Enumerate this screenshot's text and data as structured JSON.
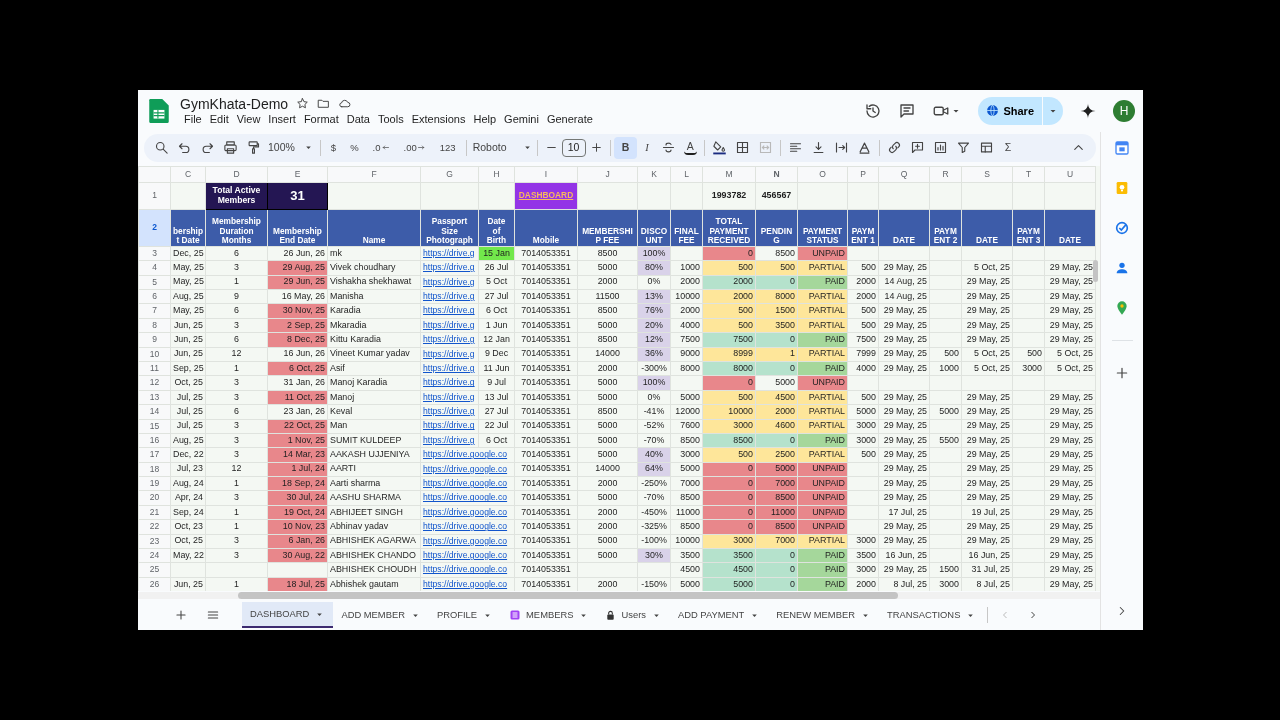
{
  "doc": {
    "title": "GymKhata-Demo",
    "menu": [
      "File",
      "Edit",
      "View",
      "Insert",
      "Format",
      "Data",
      "Tools",
      "Extensions",
      "Help",
      "Gemini",
      "Generate"
    ],
    "share_label": "Share",
    "avatar_initial": "H"
  },
  "toolbar": {
    "zoom": "100%",
    "number_formats": [
      {
        "label": "$",
        "kind": "plain"
      },
      {
        "label": "%",
        "kind": "plain"
      },
      {
        "label": ".0",
        "kind": "decrease"
      },
      {
        "label": ".00",
        "kind": "increase"
      },
      {
        "label": "123",
        "kind": "plain"
      }
    ],
    "font": "Roboto",
    "font_size": "10",
    "text_styles": [
      {
        "label": "B",
        "kind": "bold",
        "selected": true
      },
      {
        "label": "I",
        "kind": "italic",
        "selected": false
      }
    ],
    "text_color_label": "A",
    "functions_label": "Σ"
  },
  "columns": [
    {
      "letter": "C",
      "selected": false
    },
    {
      "letter": "D",
      "selected": false
    },
    {
      "letter": "E",
      "selected": false
    },
    {
      "letter": "F",
      "selected": false
    },
    {
      "letter": "G",
      "selected": false
    },
    {
      "letter": "H",
      "selected": false
    },
    {
      "letter": "I",
      "selected": false
    },
    {
      "letter": "J",
      "selected": false
    },
    {
      "letter": "K",
      "selected": false
    },
    {
      "letter": "L",
      "selected": false
    },
    {
      "letter": "M",
      "selected": false
    },
    {
      "letter": "N",
      "selected": true
    },
    {
      "letter": "O",
      "selected": false
    },
    {
      "letter": "P",
      "selected": false
    },
    {
      "letter": "Q",
      "selected": false
    },
    {
      "letter": "R",
      "selected": false
    },
    {
      "letter": "S",
      "selected": false
    },
    {
      "letter": "T",
      "selected": false
    },
    {
      "letter": "U",
      "selected": false
    }
  ],
  "summary": {
    "num": "1",
    "selected": false,
    "active_label": "Total Active Members",
    "active_count": "31",
    "dashboard_link": "DASHBOARD",
    "total_received": "1993782",
    "total_pending": "456567"
  },
  "header_row": {
    "num": "2",
    "selected": true,
    "titles": [
      "bership\nt Date",
      "Membership\nDuration\nMonths",
      "Membership\nEnd Date",
      "Name",
      "Passport\nSize\nPhotograph",
      "Date\nof\nBirth",
      "Mobile",
      "MEMBERSHI\nP FEE",
      "DISCO\nUNT",
      "FINAL\nFEE",
      "TOTAL\nPAYMENT\nRECEIVED",
      "PENDIN\nG",
      "PAYMENT\nSTATUS",
      "PAYM\nENT 1",
      "DATE",
      "PAYM\nENT 2",
      "DATE",
      "PAYM\nENT 3",
      "DATE"
    ]
  },
  "rows": [
    {
      "num": "3",
      "selected": false,
      "expired": false,
      "birthday": true,
      "discount_flag": true,
      "pending_flag": false,
      "kind": "unpaid",
      "cells": [
        "Dec, 25",
        "6",
        "26 Jun, 26",
        "mk",
        "https://drive.g",
        "15 Jan",
        "7014053351",
        "8500",
        "100%",
        null,
        "0",
        "8500",
        "UNPAID",
        null,
        null,
        null,
        null,
        null,
        null
      ]
    },
    {
      "num": "4",
      "selected": false,
      "expired": true,
      "birthday": false,
      "discount_flag": true,
      "pending_flag": true,
      "kind": "partial",
      "cells": [
        "May, 25",
        "3",
        "29 Aug, 25",
        "Vivek choudhary",
        "https://drive.g",
        "26 Jul",
        "7014053351",
        "5000",
        "80%",
        "1000",
        "500",
        "500",
        "PARTIAL",
        "500",
        "29 May, 25",
        null,
        "5 Oct, 25",
        null,
        "29 May, 25"
      ]
    },
    {
      "num": "5",
      "selected": false,
      "expired": true,
      "birthday": false,
      "discount_flag": false,
      "pending_flag": true,
      "kind": "paid",
      "cells": [
        "May, 25",
        "1",
        "29 Jun, 25",
        "Vishakha shekhawat",
        "https://drive.g",
        "5 Oct",
        "7014053351",
        "2000",
        "0%",
        "2000",
        "2000",
        "0",
        "PAID",
        "2000",
        "14 Aug, 25",
        null,
        "29 May, 25",
        null,
        "29 May, 25"
      ]
    },
    {
      "num": "6",
      "selected": false,
      "expired": false,
      "birthday": false,
      "discount_flag": true,
      "pending_flag": true,
      "kind": "partial",
      "cells": [
        "Aug, 25",
        "9",
        "16 May, 26",
        "Manisha",
        "https://drive.g",
        "27 Jul",
        "7014053351",
        "11500",
        "13%",
        "10000",
        "2000",
        "8000",
        "PARTIAL",
        "2000",
        "14 Aug, 25",
        null,
        "29 May, 25",
        null,
        "29 May, 25"
      ]
    },
    {
      "num": "7",
      "selected": false,
      "expired": true,
      "birthday": false,
      "discount_flag": true,
      "pending_flag": true,
      "kind": "partial",
      "cells": [
        "May, 25",
        "6",
        "30 Nov, 25",
        "Karadia",
        "https://drive.g",
        "6 Oct",
        "7014053351",
        "8500",
        "76%",
        "2000",
        "500",
        "1500",
        "PARTIAL",
        "500",
        "29 May, 25",
        null,
        "29 May, 25",
        null,
        "29 May, 25"
      ]
    },
    {
      "num": "8",
      "selected": false,
      "expired": true,
      "birthday": false,
      "discount_flag": true,
      "pending_flag": true,
      "kind": "partial",
      "cells": [
        "Jun, 25",
        "3",
        "2 Sep, 25",
        "Mkaradia",
        "https://drive.g",
        "1 Jun",
        "7014053351",
        "5000",
        "20%",
        "4000",
        "500",
        "3500",
        "PARTIAL",
        "500",
        "29 May, 25",
        null,
        "29 May, 25",
        null,
        "29 May, 25"
      ]
    },
    {
      "num": "9",
      "selected": false,
      "expired": true,
      "birthday": false,
      "discount_flag": true,
      "pending_flag": true,
      "kind": "paid",
      "cells": [
        "Jun, 25",
        "6",
        "8 Dec, 25",
        "Kittu Karadia",
        "https://drive.g",
        "12 Jan",
        "7014053351",
        "8500",
        "12%",
        "7500",
        "7500",
        "0",
        "PAID",
        "7500",
        "29 May, 25",
        null,
        "29 May, 25",
        null,
        "29 May, 25"
      ]
    },
    {
      "num": "10",
      "selected": false,
      "expired": false,
      "birthday": false,
      "discount_flag": true,
      "pending_flag": true,
      "kind": "partial",
      "cells": [
        "Jun, 25",
        "12",
        "16 Jun, 26",
        "Vineet Kumar yadav",
        "https://drive.g",
        "9 Dec",
        "7014053351",
        "14000",
        "36%",
        "9000",
        "8999",
        "1",
        "PARTIAL",
        "7999",
        "29 May, 25",
        "500",
        "5 Oct, 25",
        "500",
        "5 Oct, 25"
      ]
    },
    {
      "num": "11",
      "selected": false,
      "expired": true,
      "birthday": false,
      "discount_flag": false,
      "pending_flag": true,
      "kind": "paid",
      "cells": [
        "Sep, 25",
        "1",
        "6 Oct, 25",
        "Asif",
        "https://drive.g",
        "11 Jun",
        "7014053351",
        "2000",
        "-300%",
        "8000",
        "8000",
        "0",
        "PAID",
        "4000",
        "29 May, 25",
        "1000",
        "5 Oct, 25",
        "3000",
        "5 Oct, 25"
      ]
    },
    {
      "num": "12",
      "selected": false,
      "expired": false,
      "birthday": false,
      "discount_flag": true,
      "pending_flag": false,
      "kind": "unpaid",
      "cells": [
        "Oct, 25",
        "3",
        "31 Jan, 26",
        "Manoj Karadia",
        "https://drive.g",
        "9 Jul",
        "7014053351",
        "5000",
        "100%",
        null,
        "0",
        "5000",
        "UNPAID",
        null,
        null,
        null,
        null,
        null,
        null
      ]
    },
    {
      "num": "13",
      "selected": false,
      "expired": true,
      "birthday": false,
      "discount_flag": false,
      "pending_flag": true,
      "kind": "partial",
      "cells": [
        "Jul, 25",
        "3",
        "11 Oct, 25",
        "Manoj",
        "https://drive.g",
        "13 Jul",
        "7014053351",
        "5000",
        "0%",
        "5000",
        "500",
        "4500",
        "PARTIAL",
        "500",
        "29 May, 25",
        null,
        "29 May, 25",
        null,
        "29 May, 25"
      ]
    },
    {
      "num": "14",
      "selected": false,
      "expired": false,
      "birthday": false,
      "discount_flag": false,
      "pending_flag": true,
      "kind": "partial",
      "cells": [
        "Jul, 25",
        "6",
        "23 Jan, 26",
        "Keval",
        "https://drive.g",
        "27 Jul",
        "7014053351",
        "8500",
        "-41%",
        "12000",
        "10000",
        "2000",
        "PARTIAL",
        "5000",
        "29 May, 25",
        "5000",
        "29 May, 25",
        null,
        "29 May, 25"
      ]
    },
    {
      "num": "15",
      "selected": false,
      "expired": true,
      "birthday": false,
      "discount_flag": false,
      "pending_flag": true,
      "kind": "partial",
      "cells": [
        "Jul, 25",
        "3",
        "22 Oct, 25",
        "Man",
        "https://drive.g",
        "22 Jul",
        "7014053351",
        "5000",
        "-52%",
        "7600",
        "3000",
        "4600",
        "PARTIAL",
        "3000",
        "29 May, 25",
        null,
        "29 May, 25",
        null,
        "29 May, 25"
      ]
    },
    {
      "num": "16",
      "selected": false,
      "expired": true,
      "birthday": false,
      "discount_flag": false,
      "pending_flag": true,
      "kind": "paid",
      "cells": [
        "Aug, 25",
        "3",
        "1 Nov, 25",
        "SUMIT KULDEEP",
        "https://drive.g",
        "6 Oct",
        "7014053351",
        "5000",
        "-70%",
        "8500",
        "8500",
        "0",
        "PAID",
        "3000",
        "29 May, 25",
        "5500",
        "29 May, 25",
        null,
        "29 May, 25"
      ]
    },
    {
      "num": "17",
      "selected": false,
      "expired": true,
      "birthday": false,
      "discount_flag": true,
      "pending_flag": true,
      "kind": "partial",
      "cells": [
        "Dec, 22",
        "3",
        "14 Mar, 23",
        "AAKASH UJJENIYA",
        "https://drive.google.co",
        null,
        "7014053351",
        "5000",
        "40%",
        "3000",
        "500",
        "2500",
        "PARTIAL",
        "500",
        "29 May, 25",
        null,
        "29 May, 25",
        null,
        "29 May, 25"
      ]
    },
    {
      "num": "18",
      "selected": false,
      "expired": true,
      "birthday": false,
      "discount_flag": true,
      "pending_flag": true,
      "kind": "unpaid",
      "cells": [
        "Jul, 23",
        "12",
        "1 Jul, 24",
        "AARTI",
        "https://drive.google.co",
        null,
        "7014053351",
        "14000",
        "64%",
        "5000",
        "0",
        "5000",
        "UNPAID",
        null,
        "29 May, 25",
        null,
        "29 May, 25",
        null,
        "29 May, 25"
      ]
    },
    {
      "num": "19",
      "selected": false,
      "expired": true,
      "birthday": false,
      "discount_flag": false,
      "pending_flag": true,
      "kind": "unpaid",
      "cells": [
        "Aug, 24",
        "1",
        "18 Sep, 24",
        "Aarti sharma",
        "https://drive.google.co",
        null,
        "7014053351",
        "2000",
        "-250%",
        "7000",
        "0",
        "7000",
        "UNPAID",
        null,
        "29 May, 25",
        null,
        "29 May, 25",
        null,
        "29 May, 25"
      ]
    },
    {
      "num": "20",
      "selected": false,
      "expired": true,
      "birthday": false,
      "discount_flag": false,
      "pending_flag": true,
      "kind": "unpaid",
      "cells": [
        "Apr, 24",
        "3",
        "30 Jul, 24",
        "AASHU SHARMA",
        "https://drive.google.co",
        null,
        "7014053351",
        "5000",
        "-70%",
        "8500",
        "0",
        "8500",
        "UNPAID",
        null,
        "29 May, 25",
        null,
        "29 May, 25",
        null,
        "29 May, 25"
      ]
    },
    {
      "num": "21",
      "selected": false,
      "expired": true,
      "birthday": false,
      "discount_flag": false,
      "pending_flag": true,
      "kind": "unpaid",
      "cells": [
        "Sep, 24",
        "1",
        "19 Oct, 24",
        "ABHIJEET SINGH",
        "https://drive.google.co",
        null,
        "7014053351",
        "2000",
        "-450%",
        "11000",
        "0",
        "11000",
        "UNPAID",
        null,
        "17 Jul, 25",
        null,
        "19 Jul, 25",
        null,
        "29 May, 25"
      ]
    },
    {
      "num": "22",
      "selected": false,
      "expired": true,
      "birthday": false,
      "discount_flag": false,
      "pending_flag": true,
      "kind": "unpaid",
      "cells": [
        "Oct, 23",
        "1",
        "10 Nov, 23",
        "Abhinav yadav",
        "https://drive.google.co",
        null,
        "7014053351",
        "2000",
        "-325%",
        "8500",
        "0",
        "8500",
        "UNPAID",
        null,
        "29 May, 25",
        null,
        "29 May, 25",
        null,
        "29 May, 25"
      ]
    },
    {
      "num": "23",
      "selected": false,
      "expired": true,
      "birthday": false,
      "discount_flag": false,
      "pending_flag": true,
      "kind": "partial",
      "cells": [
        "Oct, 25",
        "3",
        "6 Jan, 26",
        "ABHISHEK AGARWA",
        "https://drive.google.co",
        null,
        "7014053351",
        "5000",
        "-100%",
        "10000",
        "3000",
        "7000",
        "PARTIAL",
        "3000",
        "29 May, 25",
        null,
        "29 May, 25",
        null,
        "29 May, 25"
      ]
    },
    {
      "num": "24",
      "selected": false,
      "expired": true,
      "birthday": false,
      "discount_flag": true,
      "pending_flag": true,
      "kind": "paid",
      "cells": [
        "May, 22",
        "3",
        "30 Aug, 22",
        "ABHISHEK CHANDO",
        "https://drive.google.co",
        null,
        "7014053351",
        "5000",
        "30%",
        "3500",
        "3500",
        "0",
        "PAID",
        "3500",
        "16 Jun, 25",
        null,
        "16 Jun, 25",
        null,
        "29 May, 25"
      ]
    },
    {
      "num": "25",
      "selected": false,
      "expired": false,
      "birthday": false,
      "discount_flag": false,
      "pending_flag": true,
      "kind": "paid",
      "cells": [
        null,
        null,
        null,
        "ABHISHEK CHOUDH",
        "https://drive.google.co",
        null,
        "7014053351",
        null,
        null,
        "4500",
        "4500",
        "0",
        "PAID",
        "3000",
        "29 May, 25",
        "1500",
        "31 Jul, 25",
        null,
        "29 May, 25"
      ]
    },
    {
      "num": "26",
      "selected": false,
      "expired": true,
      "birthday": false,
      "discount_flag": false,
      "pending_flag": true,
      "kind": "paid",
      "cells": [
        "Jun, 25",
        "1",
        "18 Jul, 25",
        "Abhishek gautam",
        "https://drive.google.co",
        null,
        "7014053351",
        "2000",
        "-150%",
        "5000",
        "5000",
        "0",
        "PAID",
        "2000",
        "8 Jul, 25",
        "3000",
        "8 Jul, 25",
        null,
        "29 May, 25"
      ]
    }
  ],
  "sheet_tabs": [
    {
      "label": "DASHBOARD",
      "selected": true
    },
    {
      "label": "ADD MEMBER",
      "selected": false
    },
    {
      "label": "PROFILE",
      "selected": false
    },
    {
      "label": "MEMBERS",
      "selected": false,
      "kind": "table"
    },
    {
      "label": "Users",
      "selected": false,
      "kind": "lock"
    },
    {
      "label": "ADD PAYMENT",
      "selected": false
    },
    {
      "label": "RENEW MEMBER",
      "selected": false
    },
    {
      "label": "TRANSACTIONS",
      "selected": false
    }
  ]
}
